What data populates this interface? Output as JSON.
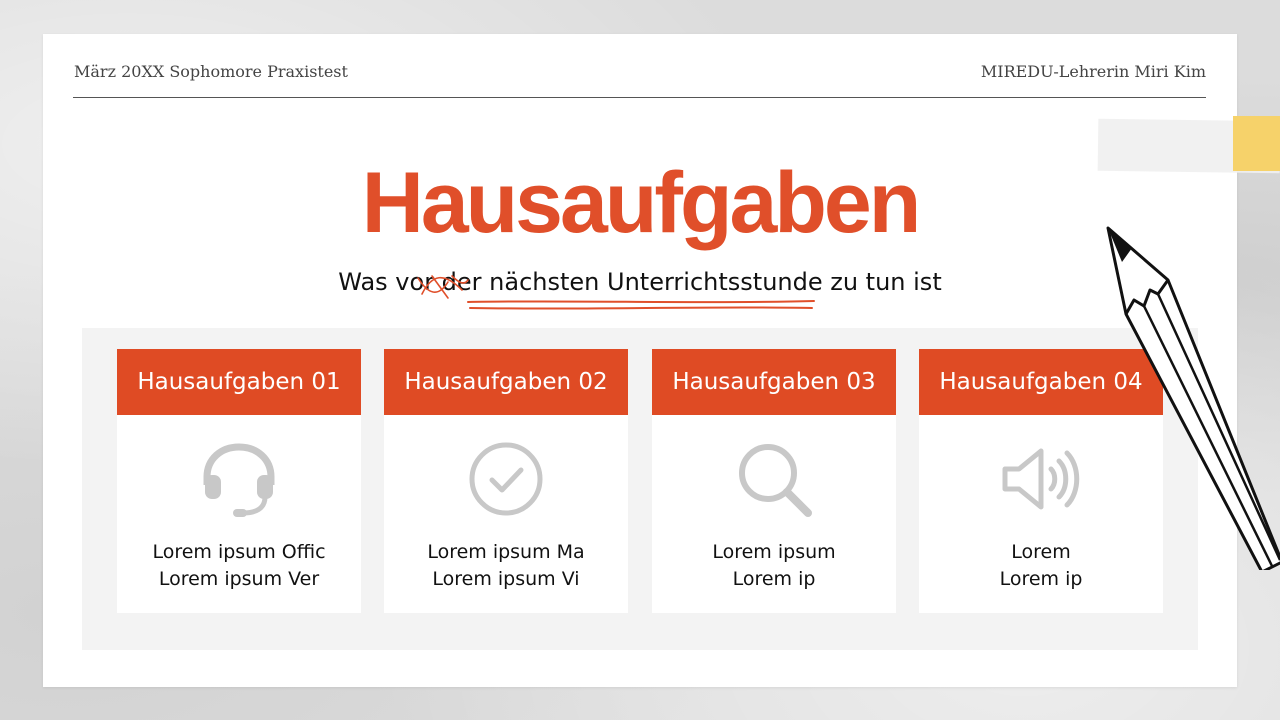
{
  "header": {
    "left": "März 20XX Sophomore Praxistest",
    "right": "MIREDU-Lehrerin Miri Kim"
  },
  "title": "Hausaufgaben",
  "subtitle": "Was vor der nächsten Unterrichtsstunde zu tun ist",
  "colors": {
    "accent": "#df4b24",
    "title": "#e04f2a",
    "icon": "#c8c8c8",
    "tape_yellow": "#f6d26a"
  },
  "cards": [
    {
      "title": "Hausaufgaben 01",
      "icon": "headset-icon",
      "line1": "Lorem ipsum Offic",
      "line2": "Lorem ipsum Ver"
    },
    {
      "title": "Hausaufgaben 02",
      "icon": "check-circle-icon",
      "line1": "Lorem ipsum Ma",
      "line2": "Lorem ipsum Vi"
    },
    {
      "title": "Hausaufgaben 03",
      "icon": "search-icon",
      "line1": "Lorem ipsum",
      "line2": "Lorem ip"
    },
    {
      "title": "Hausaufgaben 04",
      "icon": "speaker-icon",
      "line1": "Lorem",
      "line2": "Lorem ip"
    }
  ]
}
